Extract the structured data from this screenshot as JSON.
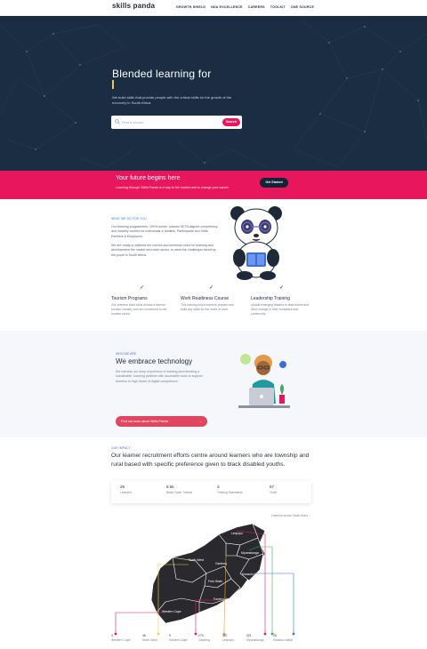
{
  "header": {
    "logo": "skills panda",
    "logo_sub": "",
    "nav": [
      "GROWTH SHIELD",
      "NDA EXCELLENCE",
      "CAREERS",
      "TOOLKIT",
      "ONE SOURCE"
    ]
  },
  "hero": {
    "title": "Blended learning for",
    "subtitle": "We build skills that provide people with the critical skills for the growth of the economy in South Africa.",
    "search_placeholder": "Find a course",
    "search_button": "Search"
  },
  "band": {
    "title": "Your future begins here",
    "subtitle": "Learning through Skills Panda is a way to the market and to change your career.",
    "button": "Get Started"
  },
  "about": {
    "kicker": "WHAT WE DO FOR YOU",
    "p1": "Our learning programmes, 100% online, unlocks SETA aligned competency and industry content for individuals & families, Participants and Skills Partners & Employers.",
    "p2": "We are ready to address the current and immense need for learning and development the market and each sector, to meet the challenges faced by the youth in South Africa.",
    "checks": [
      {
        "title": "Tourism Programs",
        "desc": "Our learners build skills across a diverse tourism industry and are connected to the tourism sector."
      },
      {
        "title": "Work Readiness Course",
        "desc": "This training helps learners prepare and build key skills for the world of work."
      },
      {
        "title": "Leadership Training",
        "desc": "Upskill emerging leaders to lead teams and drive change in their workplace and community."
      }
    ]
  },
  "tech": {
    "kicker": "WHO WE ARE",
    "title": "We embrace technology",
    "p": "We harness our deep experience in training and blending a sustainable, learning platform with accessible tools to support learners to high levels of digital competence.",
    "button": "Find out more about Skills Panda",
    "button_arrow": "→"
  },
  "recruitment": {
    "kicker": "OUR IMPACT",
    "title": "Our learner recruitment efforts centre around learners who are township and rural based with specific preference given to black disabled youths.",
    "stats": [
      {
        "value": "25",
        "label": "Learners"
      },
      {
        "value": "8.5k",
        "label": "Black Youth Trained"
      },
      {
        "value": "3",
        "label": "Training Specialists"
      },
      {
        "value": "67",
        "label": "Youth"
      }
    ],
    "map_caption": "Learners across South Africa",
    "map_labels": [
      "Limpopo",
      "North West",
      "Gauteng",
      "Mpumalanga",
      "Kwazulu-Natal",
      "Free State",
      "Eastern Cape",
      "Western Cape"
    ],
    "provinces": [
      {
        "n": "3",
        "name": "Western Cape"
      },
      {
        "n": "46",
        "name": "North West"
      },
      {
        "n": "9",
        "name": "Eastern Cape"
      },
      {
        "n": "273",
        "name": "Gauteng"
      },
      {
        "n": "387",
        "name": "Limpopo"
      },
      {
        "n": "421",
        "name": "Mpumalanga"
      },
      {
        "n": "25",
        "name": "Kwazulu-Natal"
      }
    ]
  },
  "colors": {
    "navy": "#1b2d43",
    "pink": "#e8175d",
    "blue_kicker": "#4a7ad8"
  }
}
